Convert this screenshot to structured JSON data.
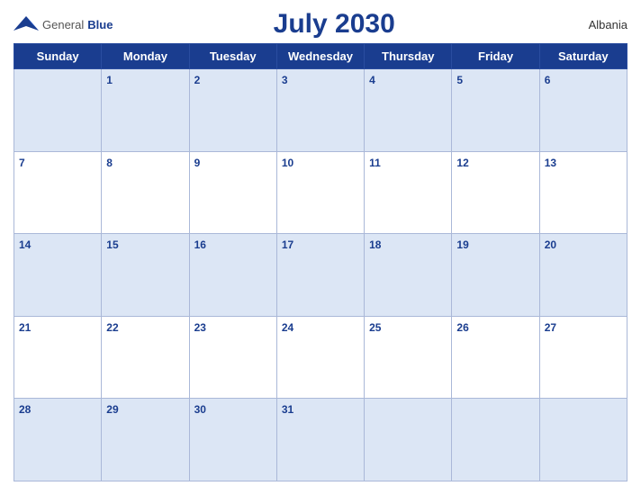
{
  "header": {
    "logo_general": "General",
    "logo_blue": "Blue",
    "title": "July 2030",
    "country": "Albania"
  },
  "days_of_week": [
    "Sunday",
    "Monday",
    "Tuesday",
    "Wednesday",
    "Thursday",
    "Friday",
    "Saturday"
  ],
  "weeks": [
    [
      null,
      1,
      2,
      3,
      4,
      5,
      6
    ],
    [
      7,
      8,
      9,
      10,
      11,
      12,
      13
    ],
    [
      14,
      15,
      16,
      17,
      18,
      19,
      20
    ],
    [
      21,
      22,
      23,
      24,
      25,
      26,
      27
    ],
    [
      28,
      29,
      30,
      31,
      null,
      null,
      null
    ]
  ]
}
